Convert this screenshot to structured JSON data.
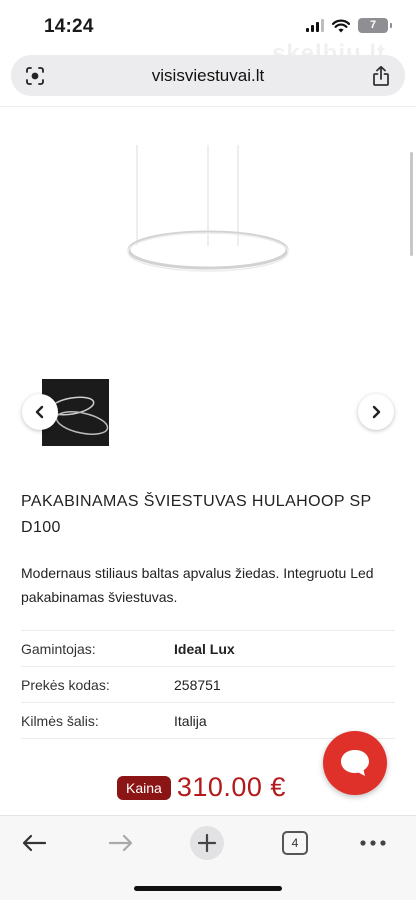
{
  "status_bar": {
    "time": "14:24",
    "battery": "7"
  },
  "browser": {
    "url": "visisviestuvai.lt",
    "watermark": "skelbiu.lt",
    "tab_count": "4"
  },
  "product": {
    "title": "PAKABINAMAS ŠVIESTUVAS HULAHOOP SP D100",
    "description": "Modernaus stiliaus baltas apvalus žiedas. Integruotu Led pakabinamas šviestuvas.",
    "specs": [
      {
        "label": "Gamintojas:",
        "value": "Ideal Lux"
      },
      {
        "label": "Prekės kodas:",
        "value": "258751"
      },
      {
        "label": "Kilmės šalis:",
        "value": "Italija"
      }
    ],
    "price_label": "Kaina",
    "price": "310.00 €"
  },
  "gallery": {
    "prev_icon": "chevron-left-icon",
    "next_icon": "chevron-right-icon"
  },
  "colors": {
    "price": "#b3191b",
    "badge": "#8b1515",
    "chat": "#e0302a"
  },
  "toolbar": {
    "icons": [
      "back-arrow-icon",
      "forward-arrow-icon",
      "plus-icon",
      "tabs-icon",
      "more-icon"
    ]
  }
}
